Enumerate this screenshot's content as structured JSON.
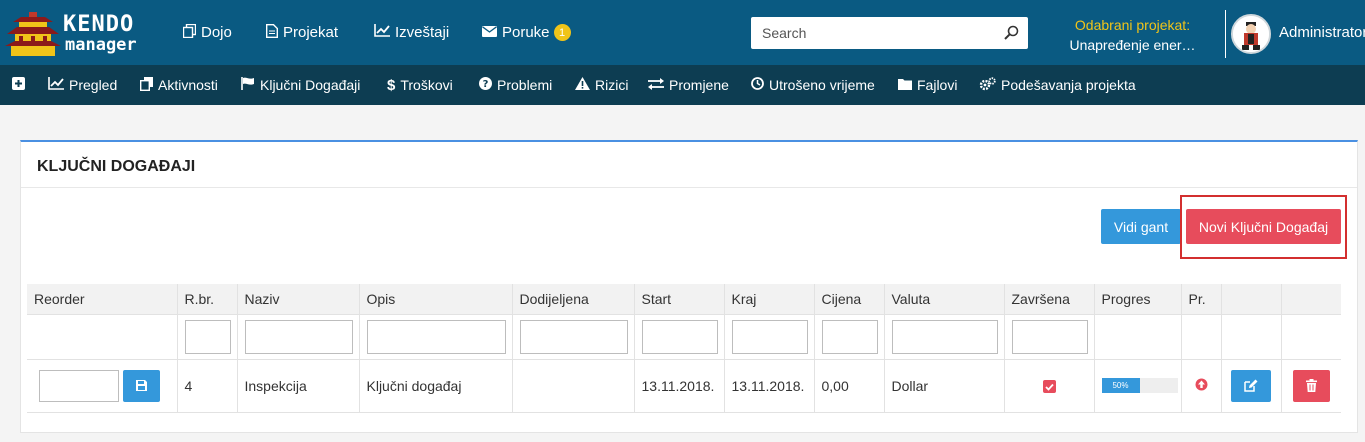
{
  "logo": {
    "line1": "KENDO",
    "line2": "manager"
  },
  "topnav": [
    {
      "label": "Dojo",
      "icon": "copy-icon"
    },
    {
      "label": "Projekat",
      "icon": "document-icon"
    },
    {
      "label": "Izveštaji",
      "icon": "line-chart-icon"
    },
    {
      "label": "Poruke",
      "icon": "envelope-icon",
      "badge": "1"
    }
  ],
  "search": {
    "placeholder": "Search",
    "value": ""
  },
  "project": {
    "label": "Odabrani projekat:",
    "value": "Unapređenje ener…"
  },
  "user": {
    "name": "Administrator"
  },
  "subnav": [
    {
      "label": "",
      "icon": "plus-square-icon"
    },
    {
      "label": "Pregled",
      "icon": "line-chart-icon"
    },
    {
      "label": "Aktivnosti",
      "icon": "copy-icon"
    },
    {
      "label": "Ključni Događaji",
      "icon": "flag-icon"
    },
    {
      "label": "Troškovi",
      "icon": "dollar-icon"
    },
    {
      "label": "Problemi",
      "icon": "question-circle-icon"
    },
    {
      "label": "Rizici",
      "icon": "warning-icon"
    },
    {
      "label": "Promjene",
      "icon": "exchange-icon"
    },
    {
      "label": "Utrošeno vrijeme",
      "icon": "clock-icon"
    },
    {
      "label": "Fajlovi",
      "icon": "folder-icon"
    },
    {
      "label": "Podešavanja projekta",
      "icon": "cogs-icon"
    }
  ],
  "panel": {
    "title": "KLJUČNI DOGAĐAJI",
    "btn_gant": "Vidi gant",
    "btn_new": "Novi Ključni Događaj"
  },
  "table": {
    "columns": [
      "Reorder",
      "R.br.",
      "Naziv",
      "Opis",
      "Dodijeljena",
      "Start",
      "Kraj",
      "Cijena",
      "Valuta",
      "Završena",
      "Progres",
      "Pr.",
      "",
      ""
    ],
    "rows": [
      {
        "reorder": "",
        "rbr": "4",
        "naziv": "Inspekcija",
        "opis": "Ključni događaj",
        "dodijeljena": "",
        "start": "13.11.2018.",
        "kraj": "13.11.2018.",
        "cijena": "0,00",
        "valuta": "Dollar",
        "zavrsena": true,
        "progres": 50,
        "progres_label": "50%"
      }
    ]
  },
  "colors": {
    "topbar": "#0a5a82",
    "subnav": "#0d3d52",
    "primary": "#3498db",
    "danger": "#e74c5c",
    "accent": "#f0c419"
  }
}
